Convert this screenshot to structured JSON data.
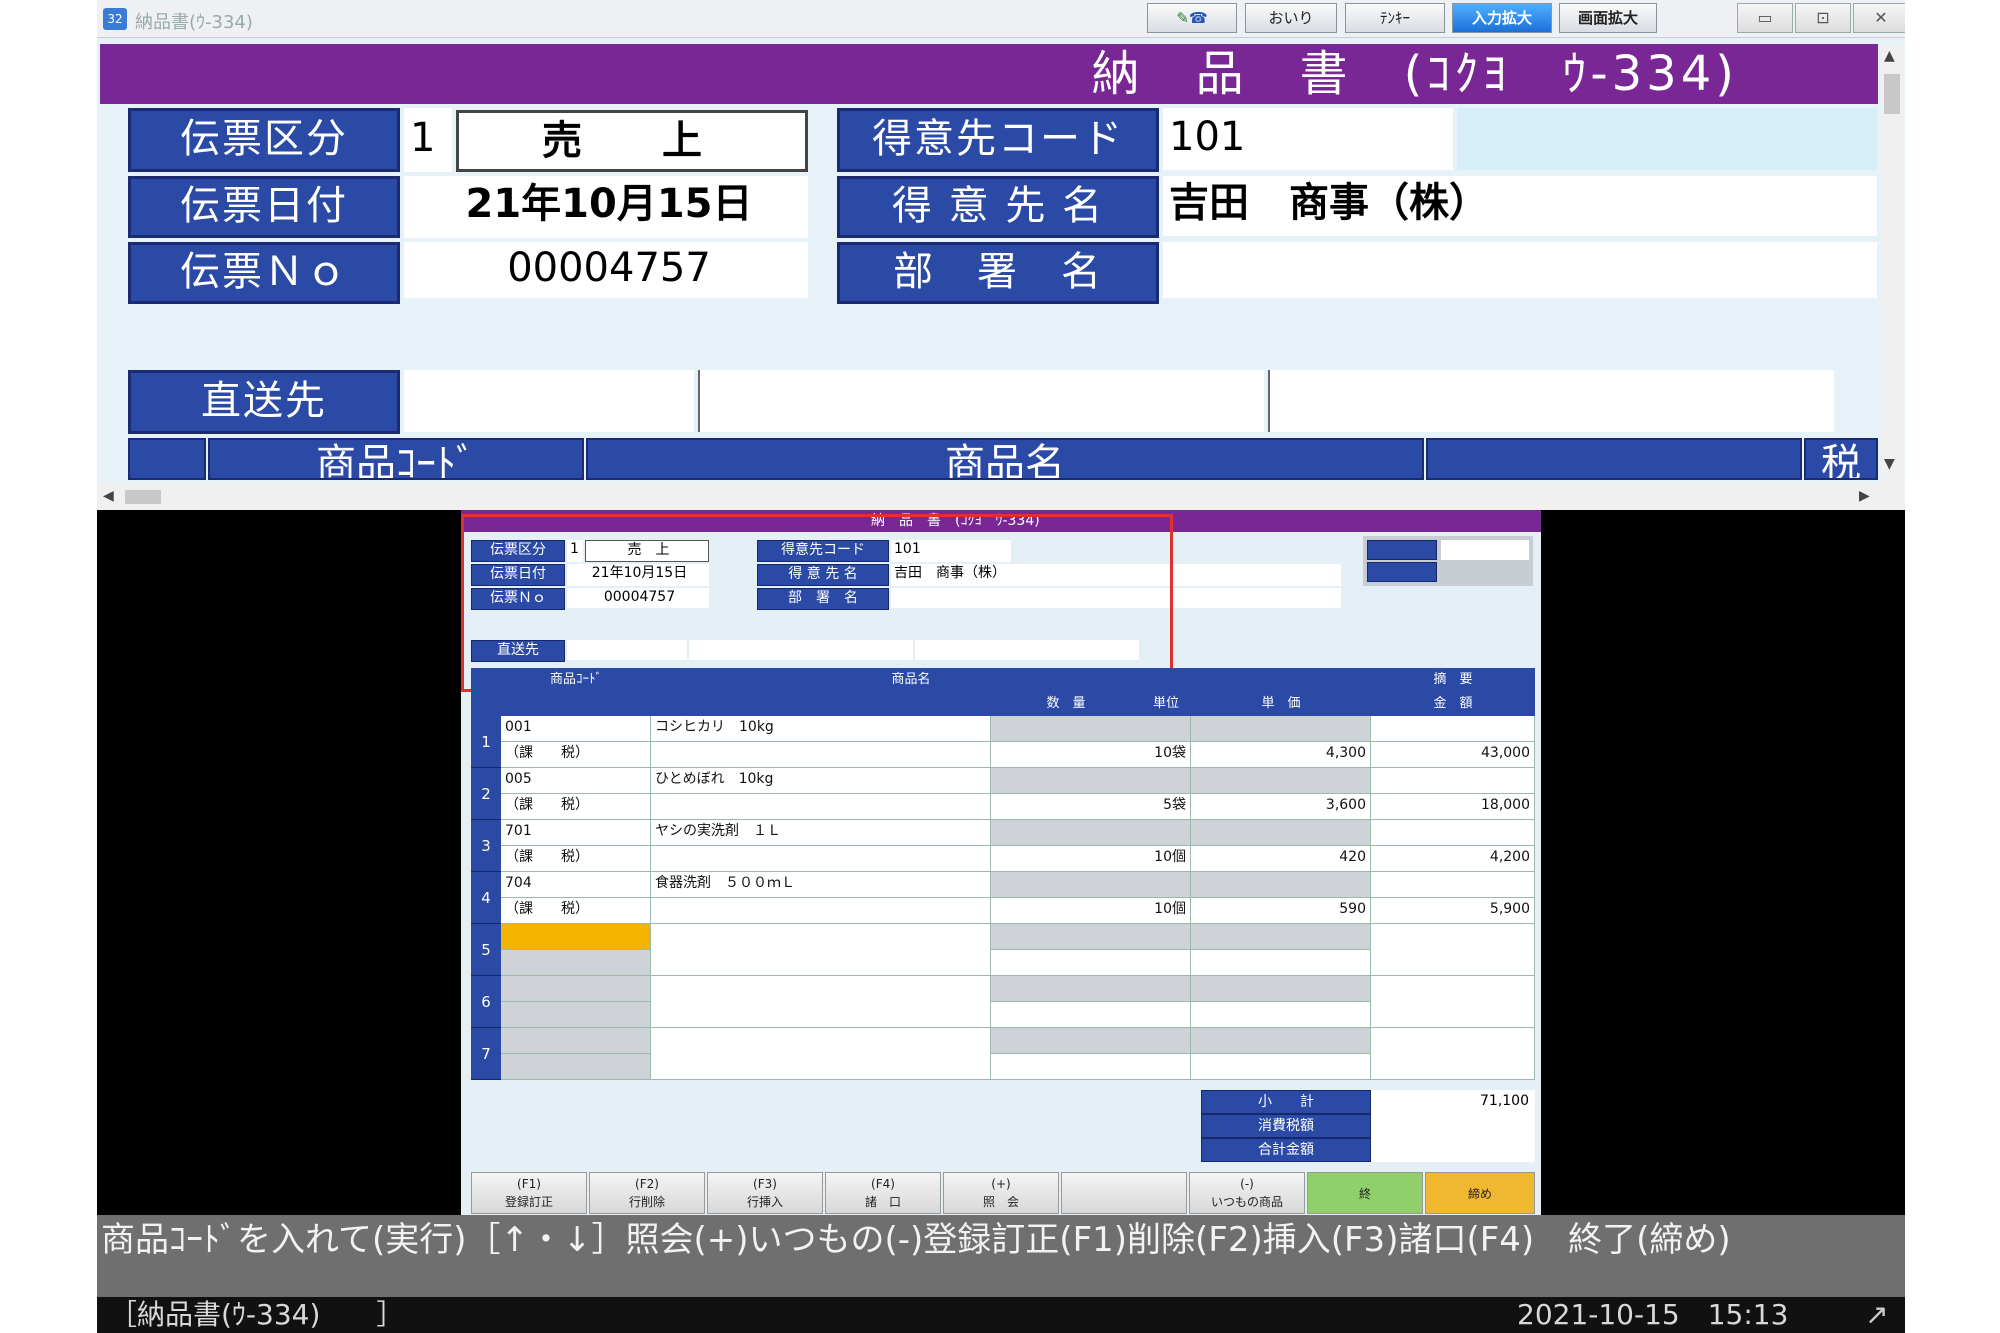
{
  "window": {
    "title": "納品書(ｳ-334)",
    "toolbar": {
      "otsuri": "おいり",
      "tenkey": "ﾃﾝｷｰ",
      "input_zoom": "入力拡大",
      "screen_zoom": "画面拡大"
    }
  },
  "form": {
    "title": "納　品　書　(ｺｸﾖ　ｳ-334)",
    "denpyo_kubun": {
      "label": "伝票区分",
      "code": "1",
      "value": "売　上"
    },
    "denpyo_hizuke": {
      "label": "伝票日付",
      "value": "21年10月15日"
    },
    "denpyo_no": {
      "label": "伝票Ｎｏ",
      "value": "00004757"
    },
    "tokuisaki_code": {
      "label": "得意先コード",
      "value": "101"
    },
    "tokuisaki_name": {
      "label": "得 意 先 名",
      "value": "吉田　商事（株）"
    },
    "busho_name": {
      "label": "部　署　名",
      "value": ""
    },
    "chokusosaki": {
      "label": "直送先"
    },
    "col_headers": {
      "code": "商品ｺｰﾄﾞ",
      "name": "商品名",
      "tax": "税"
    }
  },
  "preview": {
    "title": "納　品　書　(ｺｸﾖ　ｳ-334)",
    "header": {
      "col_qty": "数　量",
      "col_unit": "単位",
      "col_price": "単　価",
      "col_amount": "金　額",
      "col_remarks": "摘　要",
      "col_name": "商品名",
      "col_code": "商品ｺｰﾄﾞ"
    },
    "rows": [
      {
        "no": "1",
        "code": "001",
        "tax": "（課　　税）",
        "name": "コシヒカリ　10kg",
        "qty": "10袋",
        "price": "4,300",
        "amount": "43,000"
      },
      {
        "no": "2",
        "code": "005",
        "tax": "（課　　税）",
        "name": "ひとめぼれ　10kg",
        "qty": "5袋",
        "price": "3,600",
        "amount": "18,000"
      },
      {
        "no": "3",
        "code": "701",
        "tax": "（課　　税）",
        "name": "ヤシの実洗剤　１Ｌ",
        "qty": "10個",
        "price": "420",
        "amount": "4,200"
      },
      {
        "no": "4",
        "code": "704",
        "tax": "（課　　税）",
        "name": "食器洗剤　５００ｍＬ",
        "qty": "10個",
        "price": "590",
        "amount": "5,900"
      },
      {
        "no": "5"
      },
      {
        "no": "6"
      },
      {
        "no": "7"
      }
    ],
    "totals": {
      "subtotal_label": "小　　計",
      "subtotal": "71,100",
      "tax_label": "消費税額",
      "total_label": "合計金額"
    },
    "fkeys": [
      {
        "key": "(F1)",
        "label": "登録訂正"
      },
      {
        "key": "(F2)",
        "label": "行削除"
      },
      {
        "key": "(F3)",
        "label": "行挿入"
      },
      {
        "key": "(F4)",
        "label": "諸　口"
      },
      {
        "key": "(+)",
        "label": "照　会"
      },
      {
        "key": "(-)",
        "label": "いつもの商品"
      },
      {
        "key": "",
        "label": "終"
      },
      {
        "key": "",
        "label": "締め"
      }
    ]
  },
  "message": "商品ｺｰﾄﾞを入れて(実行)［↑・↓］照会(+)いつもの(-)登録訂正(F1)削除(F2)挿入(F3)諸口(F4)　終了(締め)",
  "status": {
    "left": "［納品書(ｳ-334)　　］",
    "datetime": "2021-10-15　15:13"
  },
  "colors": {
    "purple": "#7a2796",
    "blue": "#2b4aa5",
    "highlight_red": "#e03030",
    "yellow": "#f4b400",
    "green": "#8fd06a"
  }
}
